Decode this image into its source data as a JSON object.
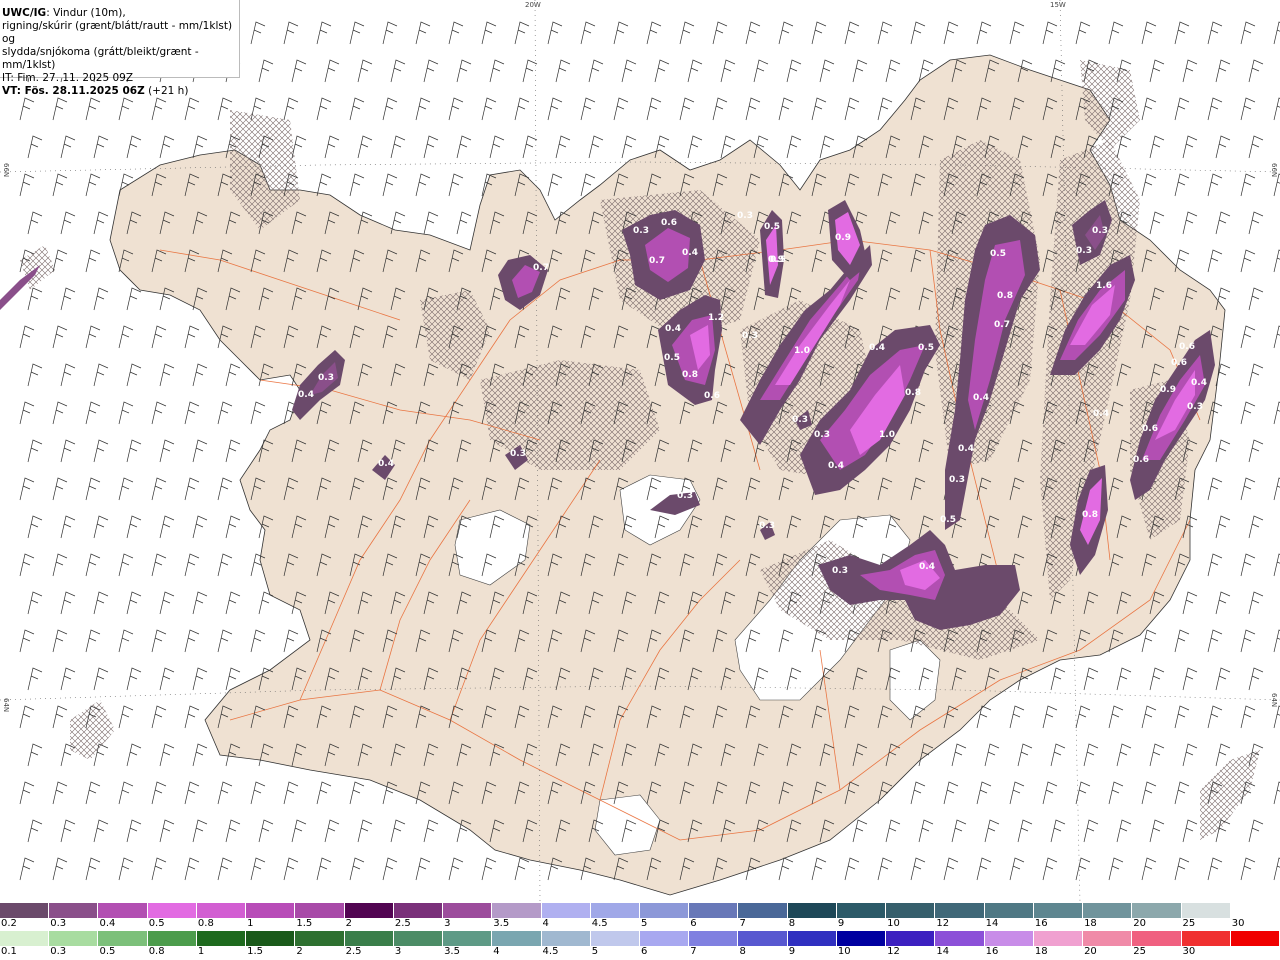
{
  "header": {
    "title_bold": "UWC/IG",
    "title_rest": ": Vindur (10m),",
    "line2": "rigning/skúrir (grænt/blátt/rautt - mm/1klst) og",
    "line3": "slydda/snjókoma (grátt/bleikt/grænt - mm/1klst)",
    "line4": "IT: Fim. 27. 11. 2025 09Z",
    "line5_bold": "VT: Fös. 28.11.2025 06Z",
    "line5_rest": " (+21 h)"
  },
  "grid_labels": {
    "lon_20w": "20W",
    "lon_15w": "15W",
    "lat_66n_left": "66N",
    "lat_66n_right": "66N",
    "lat_64n_left": "64N",
    "lat_64n_right": "64N"
  },
  "precip_labels": [
    "0.3",
    "0.6",
    "0.3",
    "0.7",
    "0.4",
    "0.9",
    "0.5",
    "0.9",
    "0.5",
    "0.3",
    "0.3",
    "0.7",
    "0.4",
    "1.2",
    "0.4",
    "0.5",
    "0.8",
    "0.6",
    "0.3",
    "1.0",
    "0.4",
    "0.5",
    "0.8",
    "0.3",
    "0.3",
    "1.0",
    "0.4",
    "0.4",
    "0.4",
    "0.5",
    "0.8",
    "0.7",
    "0.3",
    "0.3",
    "1.6",
    "0.6",
    "0.6",
    "0.4",
    "0.3",
    "0.4",
    "0.9",
    "0.6",
    "0.8",
    "0.3",
    "0.6",
    "0.5",
    "0.3",
    "0.3",
    "0.4",
    "0.3",
    "0.4"
  ],
  "colors": {
    "land": "#efe1d2",
    "sea": "#ffffff",
    "roads": "#e8632a",
    "glacier": "#ffffff",
    "snow_light": "#7a4a7a",
    "snow_mid": "#b552b5",
    "snow_heavy": "#e86ae8"
  },
  "legend_snow": {
    "labels": [
      "0.2",
      "0.3",
      "0.4",
      "0.5",
      "0.8",
      "1",
      "1.5",
      "2",
      "2.5",
      "3",
      "3.5",
      "4",
      "4.5",
      "5",
      "6",
      "7",
      "8",
      "9",
      "10",
      "12",
      "14",
      "16",
      "18",
      "20",
      "25",
      "30"
    ],
    "colors": [
      "#6b4a6b",
      "#8a4f8a",
      "#b24fb2",
      "#e26be2",
      "#d25ed2",
      "#b84cb8",
      "#a84aa8",
      "#520552",
      "#7a307a",
      "#9c4c9c",
      "#b49ac8",
      "#b0b0f0",
      "#a0a8e8",
      "#8c98d8",
      "#6878b8",
      "#4a6898",
      "#1e4858",
      "#2c5a68",
      "#365f6c",
      "#406878",
      "#4f7884",
      "#5e8690",
      "#70949c",
      "#8ca8ac",
      "#d8e0e0",
      "#ffffff"
    ]
  },
  "legend_rain": {
    "labels": [
      "0.1",
      "0.3",
      "0.5",
      "0.8",
      "1",
      "1.5",
      "2",
      "2.5",
      "3",
      "3.5",
      "4",
      "4.5",
      "5",
      "6",
      "7",
      "8",
      "9",
      "10",
      "12",
      "14",
      "16",
      "18",
      "20",
      "25",
      "30"
    ],
    "colors": [
      "#d8f0d0",
      "#a8dca0",
      "#7cc07a",
      "#4c9c4c",
      "#1e6a1e",
      "#1a5a1a",
      "#2e7030",
      "#3a7e4a",
      "#4c8c66",
      "#5e9a86",
      "#7aa6b0",
      "#a0b8d0",
      "#c0c8ec",
      "#a8a8f0",
      "#8080e0",
      "#5858d0",
      "#3030c0",
      "#0000a0",
      "#3c20c0",
      "#8c50d8",
      "#c88ce8",
      "#f0a0d0",
      "#f08aa8",
      "#f06080",
      "#f03030",
      "#f00000"
    ]
  },
  "wind": {
    "description_unit": "knots"
  }
}
